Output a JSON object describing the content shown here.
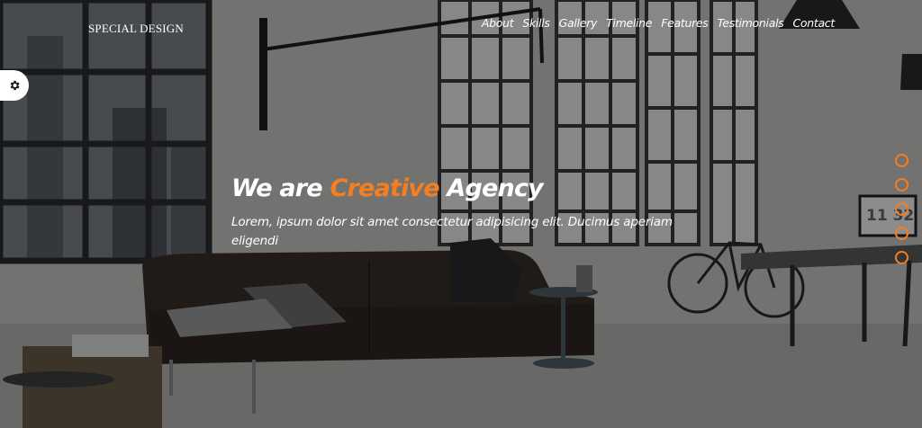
{
  "header": {
    "logo": "SPECIAL DESIGN",
    "nav": [
      "About",
      "Skills",
      "Gallery",
      "Timeline",
      "Features",
      "Testimonials",
      "Contact"
    ]
  },
  "hero": {
    "title_start": "We are",
    "title_accent": "Creative",
    "title_end": "Agency",
    "subtitle": "Lorem, ipsum dolor sit amet consectetur adipisicing elit. Ducimus aperiam eligendi",
    "clock_text": "11 32"
  },
  "slider": {
    "bullets": 5
  },
  "colors": {
    "accent": "#f47e20"
  },
  "icons": {
    "settings": "gear-icon"
  }
}
